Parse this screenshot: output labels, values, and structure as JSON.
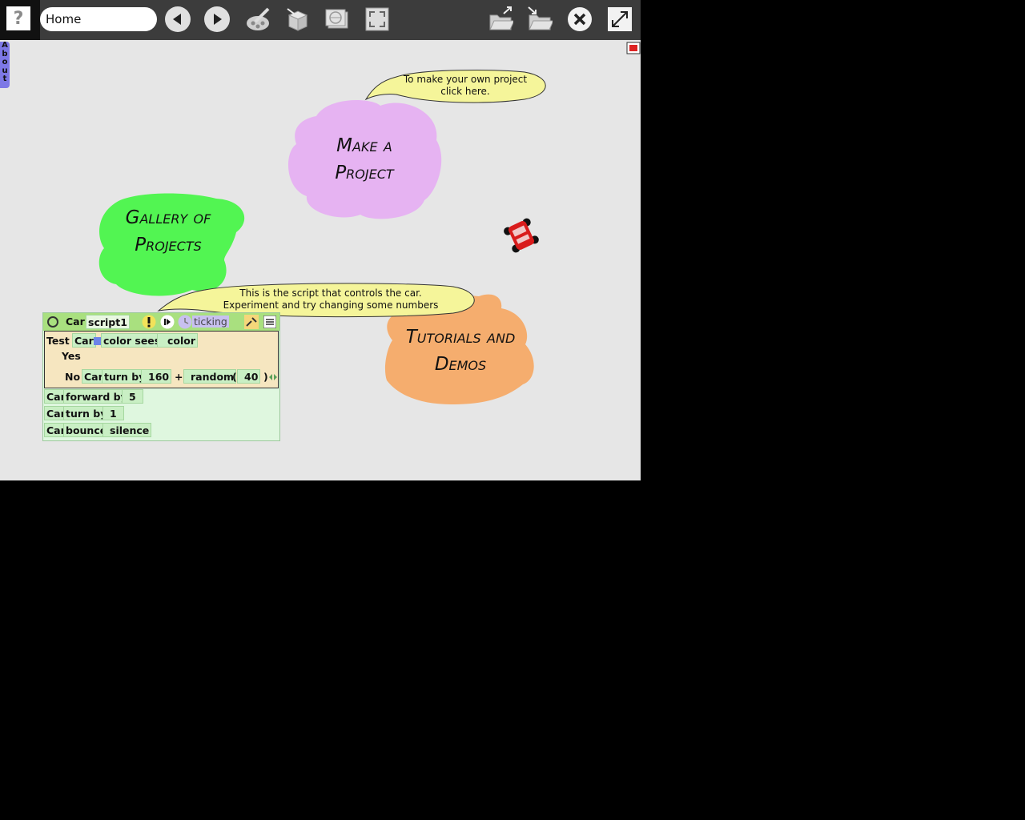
{
  "toolbar": {
    "help_label": "?",
    "project_name": "Home"
  },
  "sidebar": {
    "about_label": "A b o u t"
  },
  "clouds": {
    "make_project": "Make a Project",
    "gallery": "Gallery of Projects",
    "tutorials": "Tutorials and Demos"
  },
  "bubbles": {
    "make_project_line1": "To make your own project",
    "make_project_line2": "click here.",
    "script_line1": "This is the script that controls the car.",
    "script_line2": "Experiment and try changing some numbers"
  },
  "script": {
    "player": "Car",
    "name": "script1",
    "status": "ticking",
    "test_label": "Test",
    "test_player": "Car",
    "sees_label": "color sees",
    "color_label": "color",
    "yes_label": "Yes",
    "no_label": "No",
    "no_player": "Car",
    "turn_by_label": "turn by",
    "turn_value": "160",
    "plus_label": "+",
    "random_label": "random",
    "paren_open": "(",
    "random_value": "40",
    "paren_close": ")",
    "row1_player": "Car",
    "row1_cmd": "forward by",
    "row1_value": "5",
    "row2_player": "Car",
    "row2_cmd": "turn by",
    "row2_value": "1",
    "row3_player": "Car",
    "row3_cmd": "bounce",
    "row3_value": "silence"
  },
  "colors": {
    "make_project_cloud": "#e6b3f2",
    "gallery_cloud": "#52f552",
    "tutorials_cloud": "#f5ad6e",
    "bubble": "#f5f59a",
    "about_tab": "#7d78e6"
  }
}
